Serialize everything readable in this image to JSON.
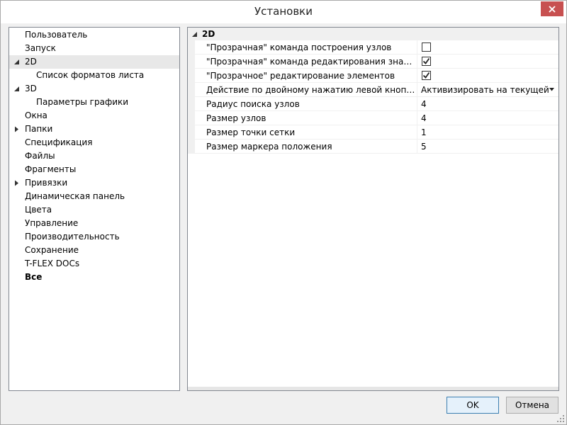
{
  "window": {
    "title": "Установки"
  },
  "tree": {
    "items": [
      {
        "label": "Пользователь",
        "level": 0,
        "expander": "none"
      },
      {
        "label": "Запуск",
        "level": 0,
        "expander": "none"
      },
      {
        "label": "2D",
        "level": 0,
        "expander": "expanded",
        "selected": true
      },
      {
        "label": "Список форматов листа",
        "level": 1,
        "expander": "none"
      },
      {
        "label": "3D",
        "level": 0,
        "expander": "expanded"
      },
      {
        "label": "Параметры графики",
        "level": 1,
        "expander": "none"
      },
      {
        "label": "Окна",
        "level": 0,
        "expander": "none"
      },
      {
        "label": "Папки",
        "level": 0,
        "expander": "collapsed"
      },
      {
        "label": "Спецификация",
        "level": 0,
        "expander": "none"
      },
      {
        "label": "Файлы",
        "level": 0,
        "expander": "none"
      },
      {
        "label": "Фрагменты",
        "level": 0,
        "expander": "none"
      },
      {
        "label": "Привязки",
        "level": 0,
        "expander": "collapsed"
      },
      {
        "label": "Динамическая панель",
        "level": 0,
        "expander": "none"
      },
      {
        "label": "Цвета",
        "level": 0,
        "expander": "none"
      },
      {
        "label": "Управление",
        "level": 0,
        "expander": "none"
      },
      {
        "label": "Производительность",
        "level": 0,
        "expander": "none"
      },
      {
        "label": "Сохранение",
        "level": 0,
        "expander": "none"
      },
      {
        "label": "T-FLEX DOCs",
        "level": 0,
        "expander": "none"
      },
      {
        "label": "Все",
        "level": 0,
        "expander": "none",
        "bold": true
      }
    ]
  },
  "properties": {
    "category": "2D",
    "rows": [
      {
        "name": "\"Прозрачная\" команда построения узлов",
        "type": "checkbox",
        "checked": false
      },
      {
        "name": "\"Прозрачная\" команда редактирования значений р...",
        "type": "checkbox",
        "checked": true
      },
      {
        "name": "\"Прозрачное\" редактирование элементов",
        "type": "checkbox",
        "checked": true
      },
      {
        "name": "Действие по двойному нажатию левой кнопки мы...",
        "type": "dropdown",
        "value": "Активизировать на текущей стра"
      },
      {
        "name": "Радиус поиска узлов",
        "type": "text",
        "value": "4"
      },
      {
        "name": "Размер узлов",
        "type": "text",
        "value": "4"
      },
      {
        "name": "Размер точки сетки",
        "type": "text",
        "value": "1"
      },
      {
        "name": "Размер маркера положения",
        "type": "text",
        "value": "5"
      }
    ]
  },
  "buttons": {
    "ok": "OK",
    "cancel": "Отмена"
  },
  "icons": {
    "close": "close-icon",
    "expanded": "triangle-expanded-icon",
    "collapsed": "triangle-collapsed-icon",
    "check": "checkmark-icon",
    "dropdown": "dropdown-arrow-icon",
    "grip": "resize-grip-icon"
  },
  "colors": {
    "close_button": "#c75050",
    "selected_row": "#e8e8e8",
    "ok_border": "#3c7fb1"
  }
}
